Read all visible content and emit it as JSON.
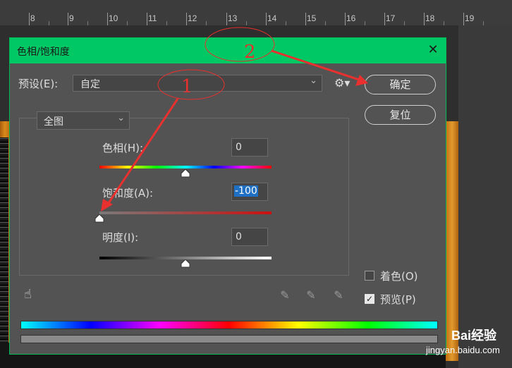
{
  "ruler": {
    "labels": [
      "8",
      "9",
      "10",
      "11",
      "12",
      "13",
      "14",
      "15",
      "16",
      "17",
      "18",
      "19"
    ]
  },
  "dialog": {
    "title": "色相/饱和度",
    "close_icon": "close-icon",
    "preset_label": "预设(E):",
    "preset_value": "自定",
    "ok_label": "确定",
    "reset_label": "复位",
    "channel_value": "全图",
    "hue_label": "色相(H):",
    "hue_value": "0",
    "saturation_label": "饱和度(A):",
    "saturation_value": "-100",
    "lightness_label": "明度(I):",
    "lightness_value": "0",
    "colorize_label": "着色(O)",
    "colorize_checked": false,
    "preview_label": "预览(P)",
    "preview_checked": true,
    "hue_level": 0.5,
    "saturation_level": 0.0,
    "lightness_level": 0.5
  },
  "annotations": {
    "marker_1": "1",
    "marker_2": "2",
    "color": "#e8302f"
  },
  "watermark": {
    "brand": "Bai经验",
    "url": "jingyan.baidu.com"
  }
}
